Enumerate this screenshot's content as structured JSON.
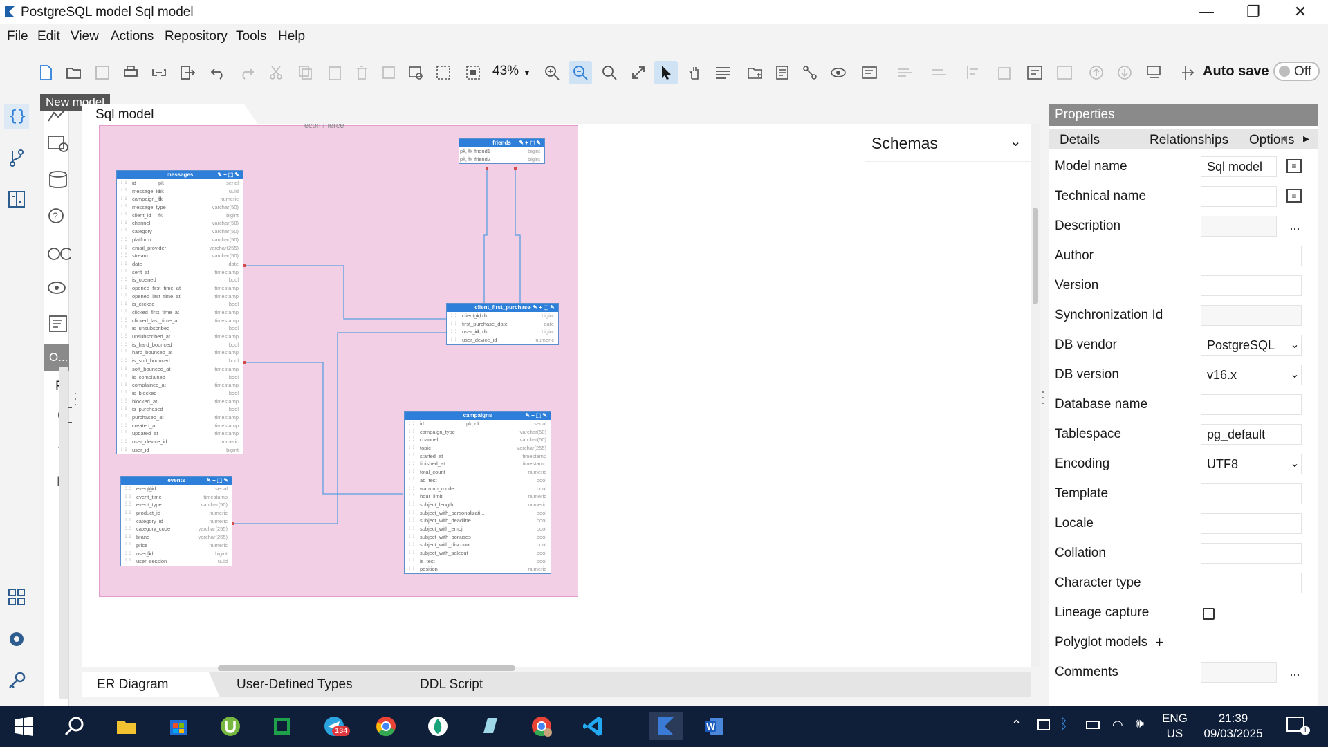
{
  "window": {
    "title": "PostgreSQL model Sql model",
    "minimize": "—",
    "restore": "❐",
    "close": "✕"
  },
  "menu": [
    "File",
    "Edit",
    "View",
    "Actions",
    "Repository",
    "Tools",
    "Help"
  ],
  "toolbar": {
    "zoom": "43%",
    "autosave_label": "Auto save",
    "autosave_state": "Off",
    "tooltip": "New model"
  },
  "secondary_panel": {
    "header": "O...",
    "letters": [
      "Fi",
      "A"
    ]
  },
  "canvas": {
    "doc_tab": "Sql model",
    "schema_label": "ecommerce",
    "schemas_title": "Schemas",
    "tables": {
      "friends": {
        "name": "friends",
        "rows": [
          [
            "friend1",
            "pk, fk",
            "bigint"
          ],
          [
            "friend2",
            "pk, fk",
            "bigint"
          ]
        ]
      },
      "client_first_purchase": {
        "name": "client_first_purchase",
        "rows": [
          [
            "client_id",
            "pk, dk",
            "bigint"
          ],
          [
            "first_purchase_date",
            "",
            "date"
          ],
          [
            "user_id",
            "uk, dk",
            "bigint"
          ],
          [
            "user_device_id",
            "",
            "numeric"
          ]
        ]
      },
      "messages": {
        "name": "messages",
        "rows": [
          [
            "id",
            "pk",
            "serial"
          ],
          [
            "message_id",
            "uk",
            "uuid"
          ],
          [
            "campaign_id",
            "fk",
            "numeric"
          ],
          [
            "message_type",
            "",
            "varchar(50)"
          ],
          [
            "client_id",
            "fk",
            "bigint"
          ],
          [
            "channel",
            "",
            "varchar(50)"
          ],
          [
            "category",
            "",
            "varchar(50)"
          ],
          [
            "platform",
            "",
            "varchar(50)"
          ],
          [
            "email_provider",
            "",
            "varchar(255)"
          ],
          [
            "stream",
            "",
            "varchar(50)"
          ],
          [
            "date",
            "",
            "date"
          ],
          [
            "sent_at",
            "",
            "timestamp"
          ],
          [
            "is_opened",
            "",
            "bool"
          ],
          [
            "opened_first_time_at",
            "",
            "timestamp"
          ],
          [
            "opened_last_time_at",
            "",
            "timestamp"
          ],
          [
            "is_clicked",
            "",
            "bool"
          ],
          [
            "clicked_first_time_at",
            "",
            "timestamp"
          ],
          [
            "clicked_last_time_at",
            "",
            "timestamp"
          ],
          [
            "is_unsubscribed",
            "",
            "bool"
          ],
          [
            "unsubscribed_at",
            "",
            "timestamp"
          ],
          [
            "is_hard_bounced",
            "",
            "bool"
          ],
          [
            "hard_bounced_at",
            "",
            "timestamp"
          ],
          [
            "is_soft_bounced",
            "",
            "bool"
          ],
          [
            "soft_bounced_at",
            "",
            "timestamp"
          ],
          [
            "is_complained",
            "",
            "bool"
          ],
          [
            "complained_at",
            "",
            "timestamp"
          ],
          [
            "is_blocked",
            "",
            "bool"
          ],
          [
            "blocked_at",
            "",
            "timestamp"
          ],
          [
            "is_purchased",
            "",
            "bool"
          ],
          [
            "purchased_at",
            "",
            "timestamp"
          ],
          [
            "created_at",
            "",
            "timestamp"
          ],
          [
            "updated_at",
            "",
            "timestamp"
          ],
          [
            "user_device_id",
            "",
            "numeric"
          ],
          [
            "user_id",
            "",
            "bigint"
          ]
        ]
      },
      "events": {
        "name": "events",
        "rows": [
          [
            "event_id",
            "pk",
            "serial"
          ],
          [
            "event_time",
            "",
            "timestamp"
          ],
          [
            "event_type",
            "",
            "varchar(50)"
          ],
          [
            "product_id",
            "",
            "numeric"
          ],
          [
            "category_id",
            "",
            "numeric"
          ],
          [
            "category_code",
            "",
            "varchar(255)"
          ],
          [
            "brand",
            "",
            "varchar(255)"
          ],
          [
            "price",
            "",
            "numeric"
          ],
          [
            "user_id",
            "fk",
            "bigint"
          ],
          [
            "user_session",
            "",
            "uuid"
          ]
        ]
      },
      "campaigns": {
        "name": "campaigns",
        "rows": [
          [
            "id",
            "pk, dk",
            "serial"
          ],
          [
            "campaign_type",
            "",
            "varchar(50)"
          ],
          [
            "channel",
            "",
            "varchar(50)"
          ],
          [
            "topic",
            "",
            "varchar(255)"
          ],
          [
            "started_at",
            "",
            "timestamp"
          ],
          [
            "finished_at",
            "",
            "timestamp"
          ],
          [
            "total_count",
            "",
            "numeric"
          ],
          [
            "ab_test",
            "",
            "bool"
          ],
          [
            "warmup_mode",
            "",
            "bool"
          ],
          [
            "hour_limit",
            "",
            "numeric"
          ],
          [
            "subject_length",
            "",
            "numeric"
          ],
          [
            "subject_with_personalizati...",
            "",
            "bool"
          ],
          [
            "subject_with_deadline",
            "",
            "bool"
          ],
          [
            "subject_with_emoji",
            "",
            "bool"
          ],
          [
            "subject_with_bonuses",
            "",
            "bool"
          ],
          [
            "subject_with_discount",
            "",
            "bool"
          ],
          [
            "subject_with_saleout",
            "",
            "bool"
          ],
          [
            "is_test",
            "",
            "bool"
          ],
          [
            "position",
            "",
            "numeric"
          ]
        ]
      }
    }
  },
  "bottom_tabs": [
    "ER Diagram",
    "User-Defined Types",
    "DDL Script"
  ],
  "properties": {
    "header": "Properties",
    "tabs": [
      "Details",
      "Relationships",
      "Options"
    ],
    "rows": [
      {
        "label": "Model name",
        "value": "Sql model"
      },
      {
        "label": "Technical name",
        "value": ""
      },
      {
        "label": "Description",
        "value": ""
      },
      {
        "label": "Author",
        "value": ""
      },
      {
        "label": "Version",
        "value": ""
      },
      {
        "label": "Synchronization Id",
        "value": ""
      },
      {
        "label": "DB vendor",
        "value": "PostgreSQL"
      },
      {
        "label": "DB version",
        "value": "v16.x"
      },
      {
        "label": "Database name",
        "value": ""
      },
      {
        "label": "Tablespace",
        "value": "pg_default"
      },
      {
        "label": "Encoding",
        "value": "UTF8"
      },
      {
        "label": "Template",
        "value": ""
      },
      {
        "label": "Locale",
        "value": ""
      },
      {
        "label": "Collation",
        "value": ""
      },
      {
        "label": "Character type",
        "value": ""
      },
      {
        "label": "Lineage capture",
        "value": ""
      },
      {
        "label": "Polyglot models",
        "value": ""
      },
      {
        "label": "Comments",
        "value": ""
      }
    ],
    "ellipsis": "...",
    "plus": "+",
    "left_arrow": "◂",
    "right_arrow": "▸"
  },
  "taskbar": {
    "lang": "ENG",
    "region": "US",
    "time": "21:39",
    "date": "09/03/2025",
    "telegram_badge": "134",
    "notif_badge": "1"
  }
}
